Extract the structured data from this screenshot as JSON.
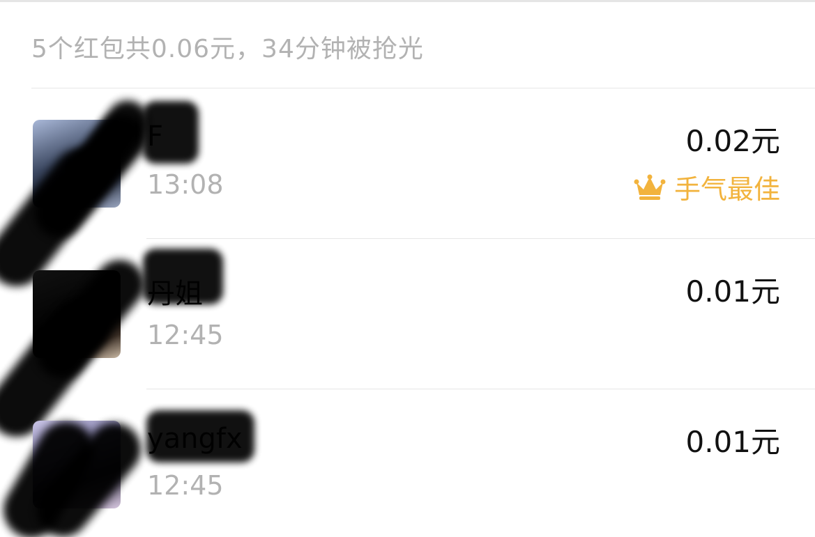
{
  "summary": "5个红包共0.06元，34分钟被抢光",
  "records": [
    {
      "name": "F",
      "time": "13:08",
      "amount": "0.02元",
      "badge": "手气最佳",
      "badge_icon": "crown-icon"
    },
    {
      "name": "丹姐",
      "time": "12:45",
      "amount": "0.01元"
    },
    {
      "name": "yangfx",
      "time": "12:45",
      "amount": "0.01元"
    }
  ],
  "colors": {
    "secondary_text": "#b2b2b2",
    "primary_text": "#111111",
    "best_luck": "#f2b33d",
    "divider": "#e6e6e6"
  }
}
